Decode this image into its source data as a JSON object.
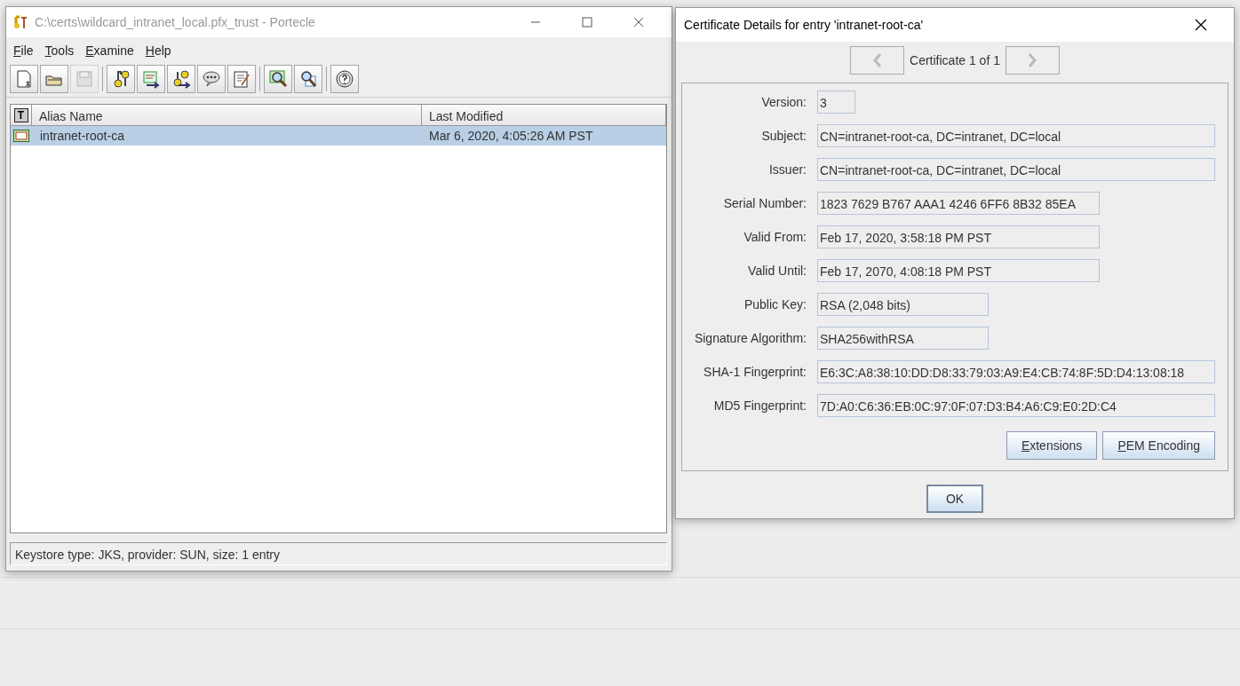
{
  "main_window": {
    "title": "C:\\certs\\wildcard_intranet_local.pfx_trust - Portecle",
    "menu": [
      "File",
      "Tools",
      "Examine",
      "Help"
    ],
    "toolbar": [
      {
        "buttons": [
          {
            "kind": "new",
            "disabled": false
          },
          {
            "kind": "open",
            "disabled": false
          },
          {
            "kind": "save",
            "disabled": true
          }
        ]
      },
      {
        "buttons": [
          {
            "kind": "genkey",
            "disabled": false
          },
          {
            "kind": "importcert",
            "disabled": false
          },
          {
            "kind": "importkey",
            "disabled": false
          },
          {
            "kind": "comment",
            "disabled": false
          },
          {
            "kind": "properties",
            "disabled": false
          }
        ]
      },
      {
        "buttons": [
          {
            "kind": "examinefile",
            "disabled": false
          },
          {
            "kind": "examinessl",
            "disabled": false
          }
        ]
      },
      {
        "buttons": [
          {
            "kind": "help",
            "disabled": false
          }
        ]
      }
    ],
    "table": {
      "type_column": "T",
      "columns": [
        "Alias Name",
        "Last Modified"
      ],
      "rows": [
        {
          "alias": "intranet-root-ca",
          "modified": "Mar 6, 2020, 4:05:26 AM PST",
          "selected": true
        }
      ]
    },
    "status_bar": "Keystore type: JKS, provider: SUN, size: 1 entry"
  },
  "dialog": {
    "title": "Certificate Details for entry 'intranet-root-ca'",
    "navigator": {
      "label": "Certificate 1 of 1",
      "prev_disabled": true,
      "next_disabled": true
    },
    "fields": [
      {
        "label": "Version:",
        "value": "3"
      },
      {
        "label": "Subject:",
        "value": "CN=intranet-root-ca, DC=intranet, DC=local"
      },
      {
        "label": "Issuer:",
        "value": "CN=intranet-root-ca, DC=intranet, DC=local"
      },
      {
        "label": "Serial Number:",
        "value": "1823 7629 B767 AAA1 4246 6FF6 8B32 85EA"
      },
      {
        "label": "Valid From:",
        "value": "Feb 17, 2020, 3:58:18 PM PST"
      },
      {
        "label": "Valid Until:",
        "value": "Feb 17, 2070, 4:08:18 PM PST"
      },
      {
        "label": "Public Key:",
        "value": "RSA (2,048 bits)"
      },
      {
        "label": "Signature Algorithm:",
        "value": "SHA256withRSA"
      },
      {
        "label": "SHA-1 Fingerprint:",
        "value": "E6:3C:A8:38:10:DD:D8:33:79:03:A9:E4:CB:74:8F:5D:D4:13:08:18"
      },
      {
        "label": "MD5 Fingerprint:",
        "value": "7D:A0:C6:36:EB:0C:97:0F:07:D3:B4:A6:C9:E0:2D:C4"
      }
    ],
    "buttons": [
      "Extensions",
      "PEM Encoding"
    ],
    "ok_button": "OK"
  }
}
